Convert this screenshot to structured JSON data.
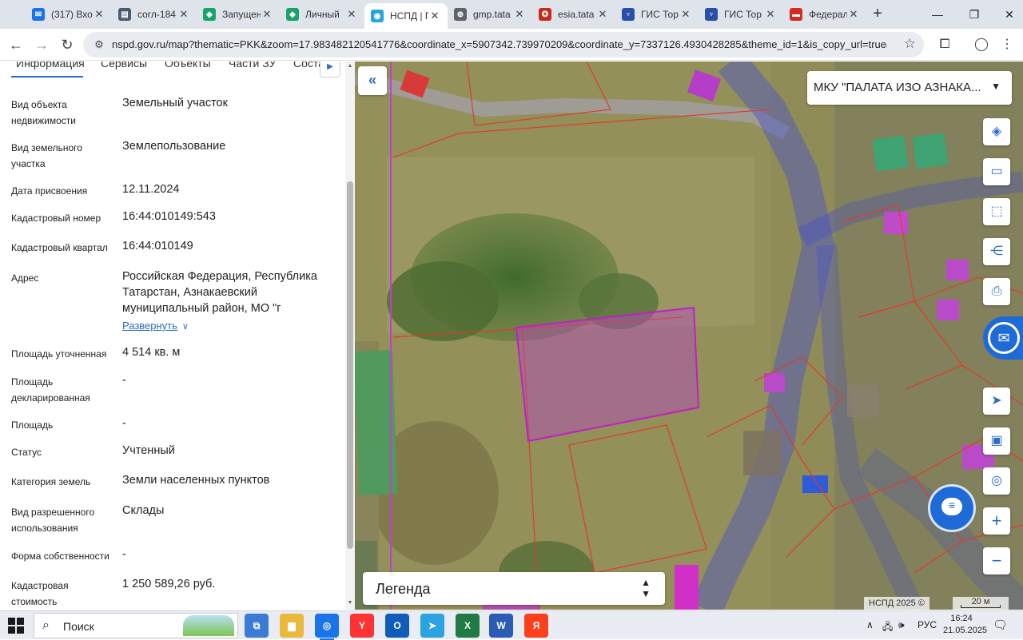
{
  "browser": {
    "tabs": [
      {
        "label": "(317) Вхо",
        "favicon": "mail-icon",
        "color": "#1a73e8",
        "glyph": "✉"
      },
      {
        "label": "согл-184",
        "favicon": "doc-icon",
        "color": "#4a5a70",
        "glyph": "▤"
      },
      {
        "label": "Запущен",
        "favicon": "gosuslugi-icon",
        "color": "#18a36b",
        "glyph": "◆"
      },
      {
        "label": "Личный",
        "favicon": "gosuslugi-icon",
        "color": "#18a36b",
        "glyph": "◆"
      },
      {
        "label": "НСПД | П",
        "favicon": "nspd-icon",
        "color": "#29a3d8",
        "glyph": "◉",
        "active": true
      },
      {
        "label": "gmp.tata",
        "favicon": "globe-icon",
        "color": "#5f6368",
        "glyph": "⊕"
      },
      {
        "label": "esia.tata",
        "favicon": "emblem-icon",
        "color": "#c8281e",
        "glyph": "✪"
      },
      {
        "label": "ГИС Тор",
        "favicon": "eagle-icon",
        "color": "#2a4fa8",
        "glyph": "♆"
      },
      {
        "label": "ГИС Тор",
        "favicon": "eagle-icon",
        "color": "#2a4fa8",
        "glyph": "♆"
      },
      {
        "label": "Федерал",
        "favicon": "flag-icon",
        "color": "#d52b1e",
        "glyph": "▬"
      }
    ],
    "new_tab": "+",
    "url": "nspd.gov.ru/map?thematic=PKK&zoom=17.983482120541776&coordinate_x=5907342.739970209&coordinate_y=7337126.4930428285&theme_id=1&is_copy_url=true&active..."
  },
  "panel": {
    "tabs": [
      "Информация",
      "Сервисы",
      "Объекты",
      "Части ЗУ",
      "Соста"
    ],
    "rows": [
      {
        "label": "Вид объекта недвижимости",
        "value": "Земельный участок"
      },
      {
        "label": "Вид земельного участка",
        "value": "Землепользование"
      },
      {
        "label": "Дата присвоения",
        "value": "12.11.2024"
      },
      {
        "label": "Кадастровый номер",
        "value": "16:44:010149:543"
      },
      {
        "label": "Кадастровый квартал",
        "value": "16:44:010149"
      },
      {
        "label": "Адрес",
        "value": "Российская Федерация, Республика Татарстан, Азнакаевский муниципальный район, МО \"г"
      },
      {
        "label": "Площадь уточненная",
        "value": "4 514 кв. м"
      },
      {
        "label": "Площадь декларированная",
        "value": "-"
      },
      {
        "label": "Площадь",
        "value": "-"
      },
      {
        "label": "Статус",
        "value": "Учтенный"
      },
      {
        "label": "Категория земель",
        "value": "Земли населенных пунктов"
      },
      {
        "label": "Вид разрешенного использования",
        "value": "Склады"
      },
      {
        "label": "Форма собственности",
        "value": "-"
      },
      {
        "label": "Кадастровая стоимость",
        "value": "1 250 589,26 руб."
      }
    ],
    "expand_label": "Развернуть"
  },
  "map": {
    "org_selector": "МКУ \"ПАЛАТА ИЗО АЗНАКА...",
    "legend_label": "Легенда",
    "attribution": "НСПД 2025 ©",
    "scale_label": "20 м",
    "tools": [
      "layers-icon",
      "ruler-icon",
      "select-area-icon",
      "share-icon",
      "print-icon",
      "gosuslugi-feedback-icon",
      "locate-icon",
      "picture-in-picture-icon",
      "geolocation-icon",
      "zoom-in-icon",
      "zoom-out-icon"
    ],
    "colors": {
      "selected_parcel": "#c020c0",
      "parcel_border": "#e03b2b",
      "quarter_border": "#3b4bd8"
    }
  },
  "taskbar": {
    "search_label": "Поиск",
    "apps": [
      {
        "name": "taskview-app",
        "color": "#3a7bd5",
        "glyph": "⧉"
      },
      {
        "name": "explorer-app",
        "color": "#e8b93a",
        "glyph": "▆"
      },
      {
        "name": "chrome-app",
        "color": "#1a73e8",
        "glyph": "◎",
        "active": true
      },
      {
        "name": "yandex-browser-app",
        "color": "#ff3333",
        "glyph": "Y"
      },
      {
        "name": "outlook-app",
        "color": "#0f5db8",
        "glyph": "O"
      },
      {
        "name": "telegram-app",
        "color": "#2aa3e0",
        "glyph": "➤"
      },
      {
        "name": "excel-app",
        "color": "#1f7a44",
        "glyph": "X"
      },
      {
        "name": "word-app",
        "color": "#2b5bb5",
        "glyph": "W"
      },
      {
        "name": "yandex-app",
        "color": "#fc3f1d",
        "glyph": "Я"
      }
    ],
    "language": "РУС",
    "time": "16:24",
    "date": "21.05.2025"
  }
}
